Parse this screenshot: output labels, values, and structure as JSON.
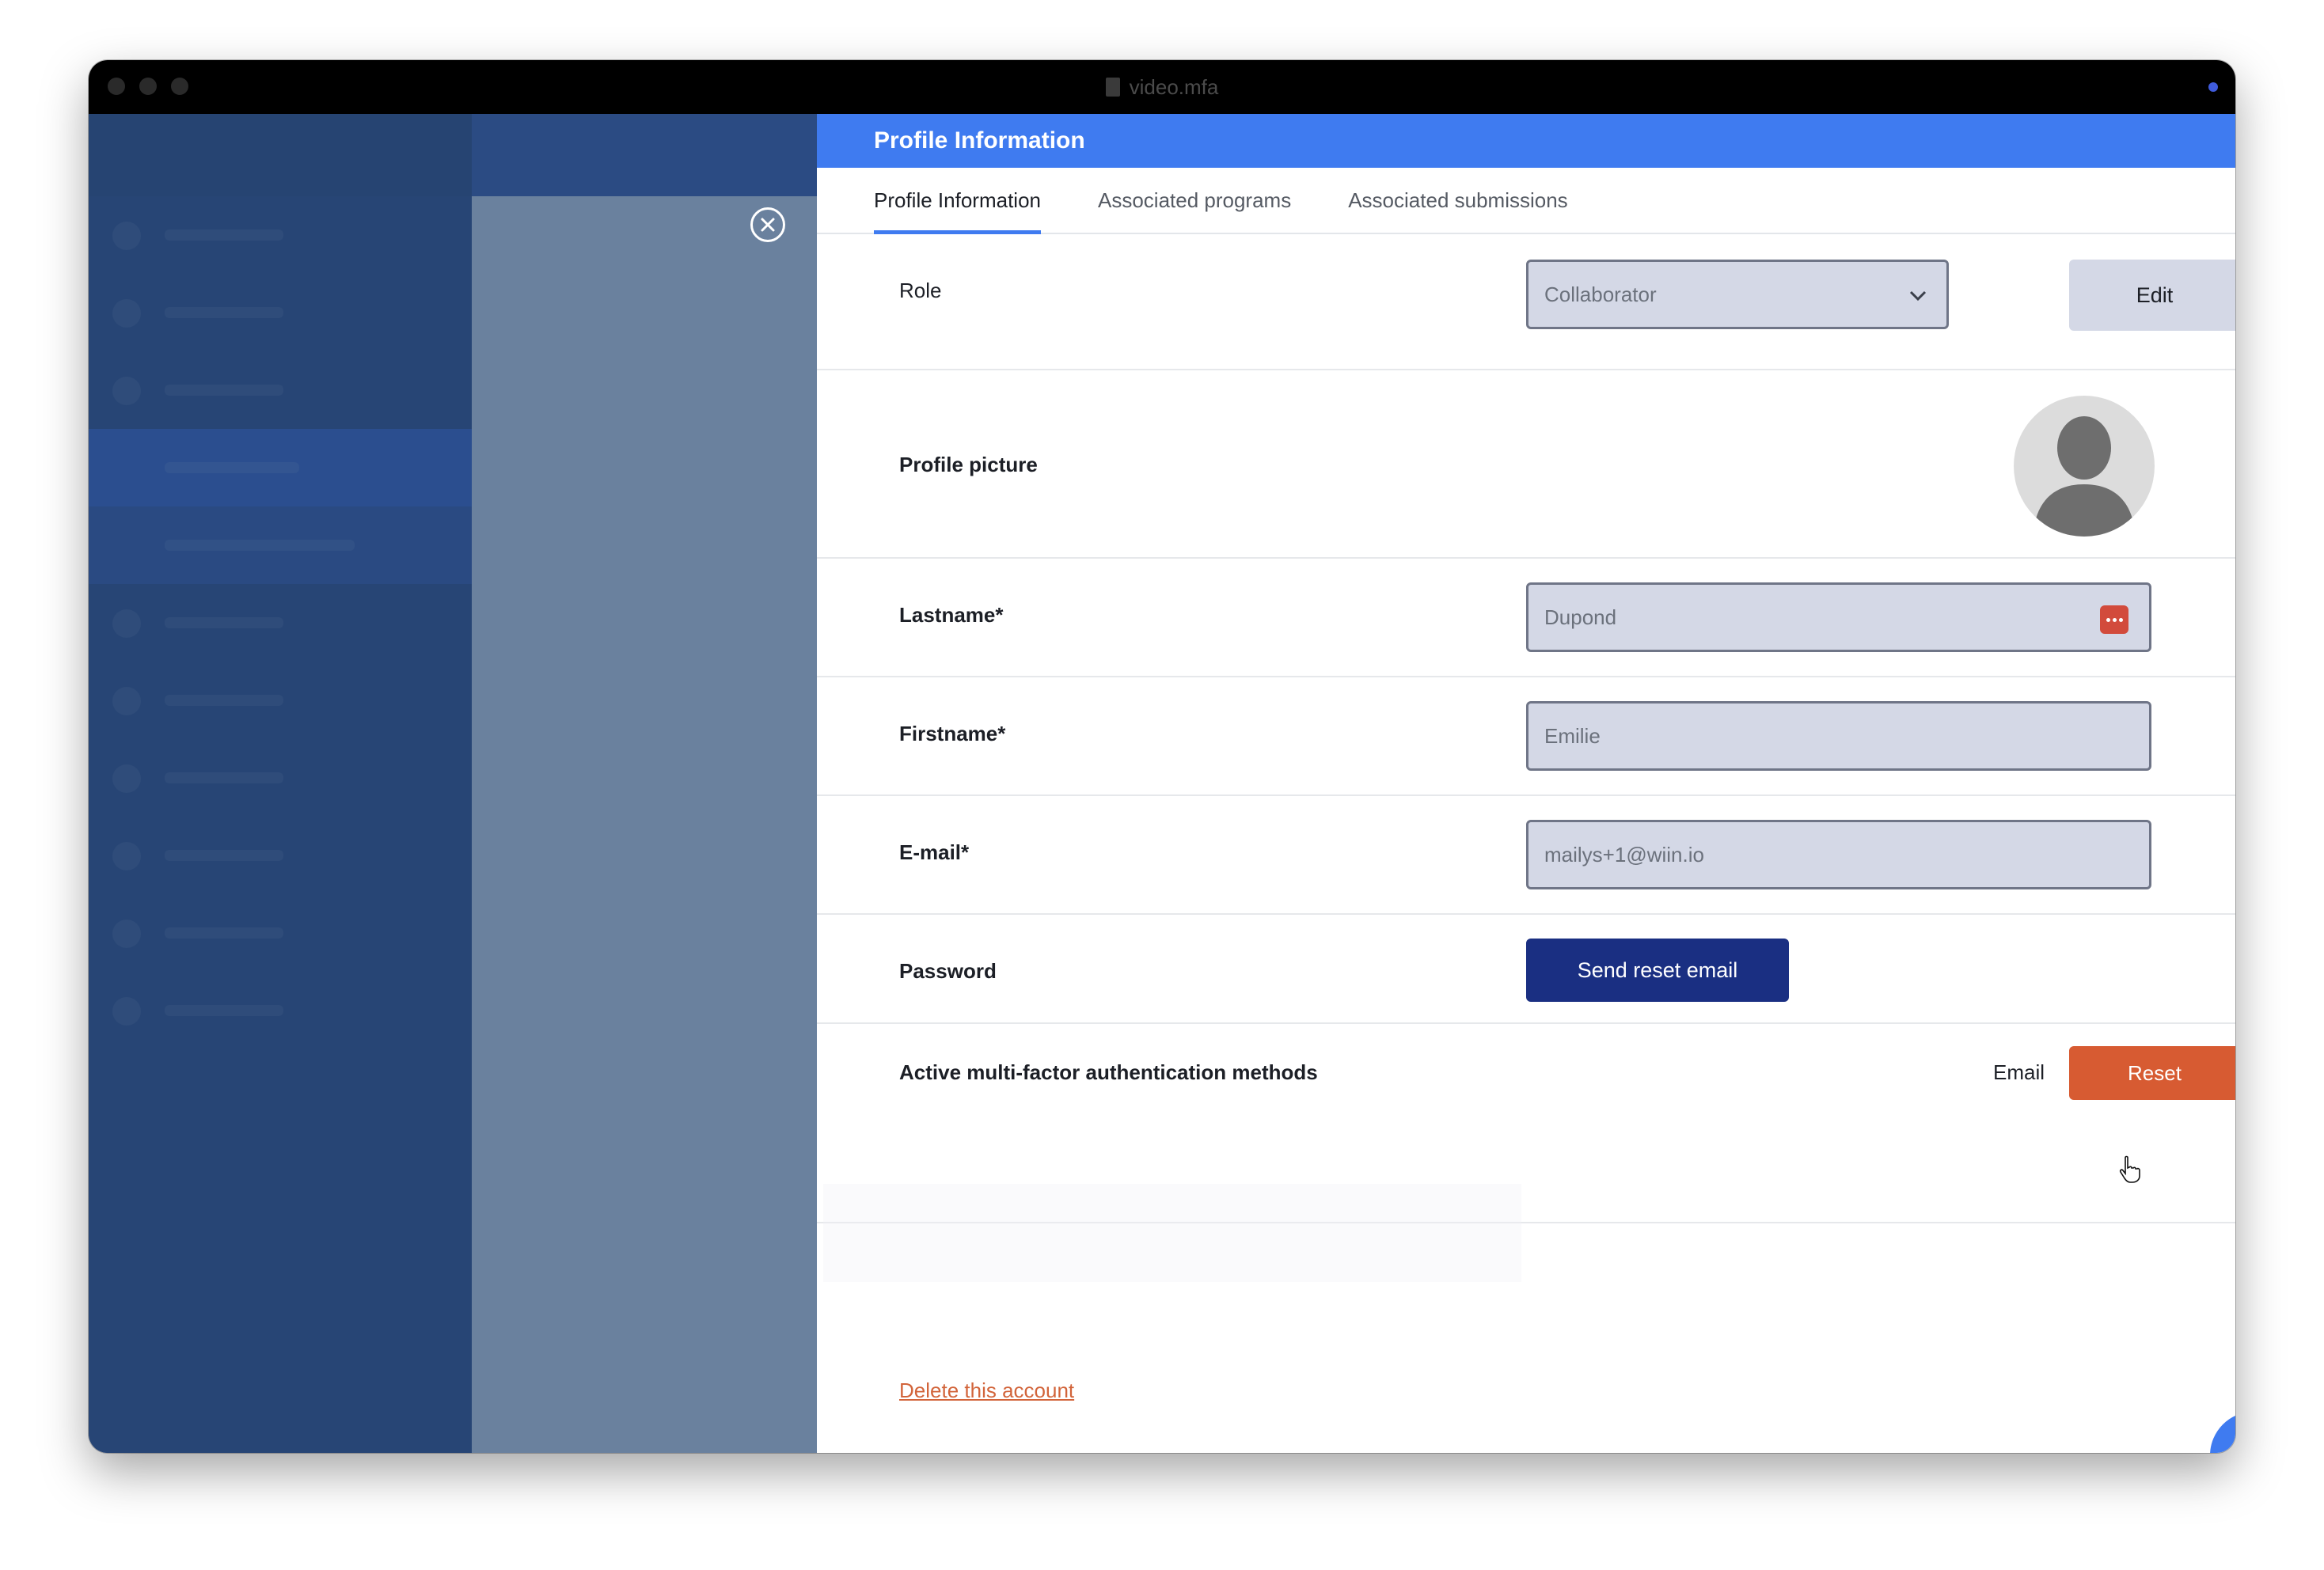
{
  "window": {
    "title": "video.mfa"
  },
  "drawer": {
    "header_title": "Profile Information",
    "tabs": [
      {
        "label": "Profile Information",
        "active": true
      },
      {
        "label": "Associated programs",
        "active": false
      },
      {
        "label": "Associated submissions",
        "active": false
      }
    ],
    "role": {
      "label": "Role",
      "value": "Collaborator",
      "edit_label": "Edit"
    },
    "profile_picture": {
      "label": "Profile picture"
    },
    "lastname": {
      "label": "Lastname*",
      "value": "Dupond"
    },
    "firstname": {
      "label": "Firstname*",
      "value": "Emilie"
    },
    "email": {
      "label": "E-mail*",
      "value": "mailys+1@wiin.io"
    },
    "password": {
      "label": "Password",
      "button_label": "Send reset email"
    },
    "mfa": {
      "label": "Active multi-factor authentication methods",
      "method": "Email",
      "reset_label": "Reset"
    },
    "delete_label": "Delete this account"
  },
  "colors": {
    "accent": "#3f7bf0",
    "primary_button": "#1a2f82",
    "reset_button": "#d75b32",
    "delete_link": "#d2643a"
  },
  "icons": {
    "close": "close-circle-icon",
    "select": "chevron-down-icon",
    "password_manager": "password-manager-icon",
    "help": "lightbulb-icon"
  }
}
